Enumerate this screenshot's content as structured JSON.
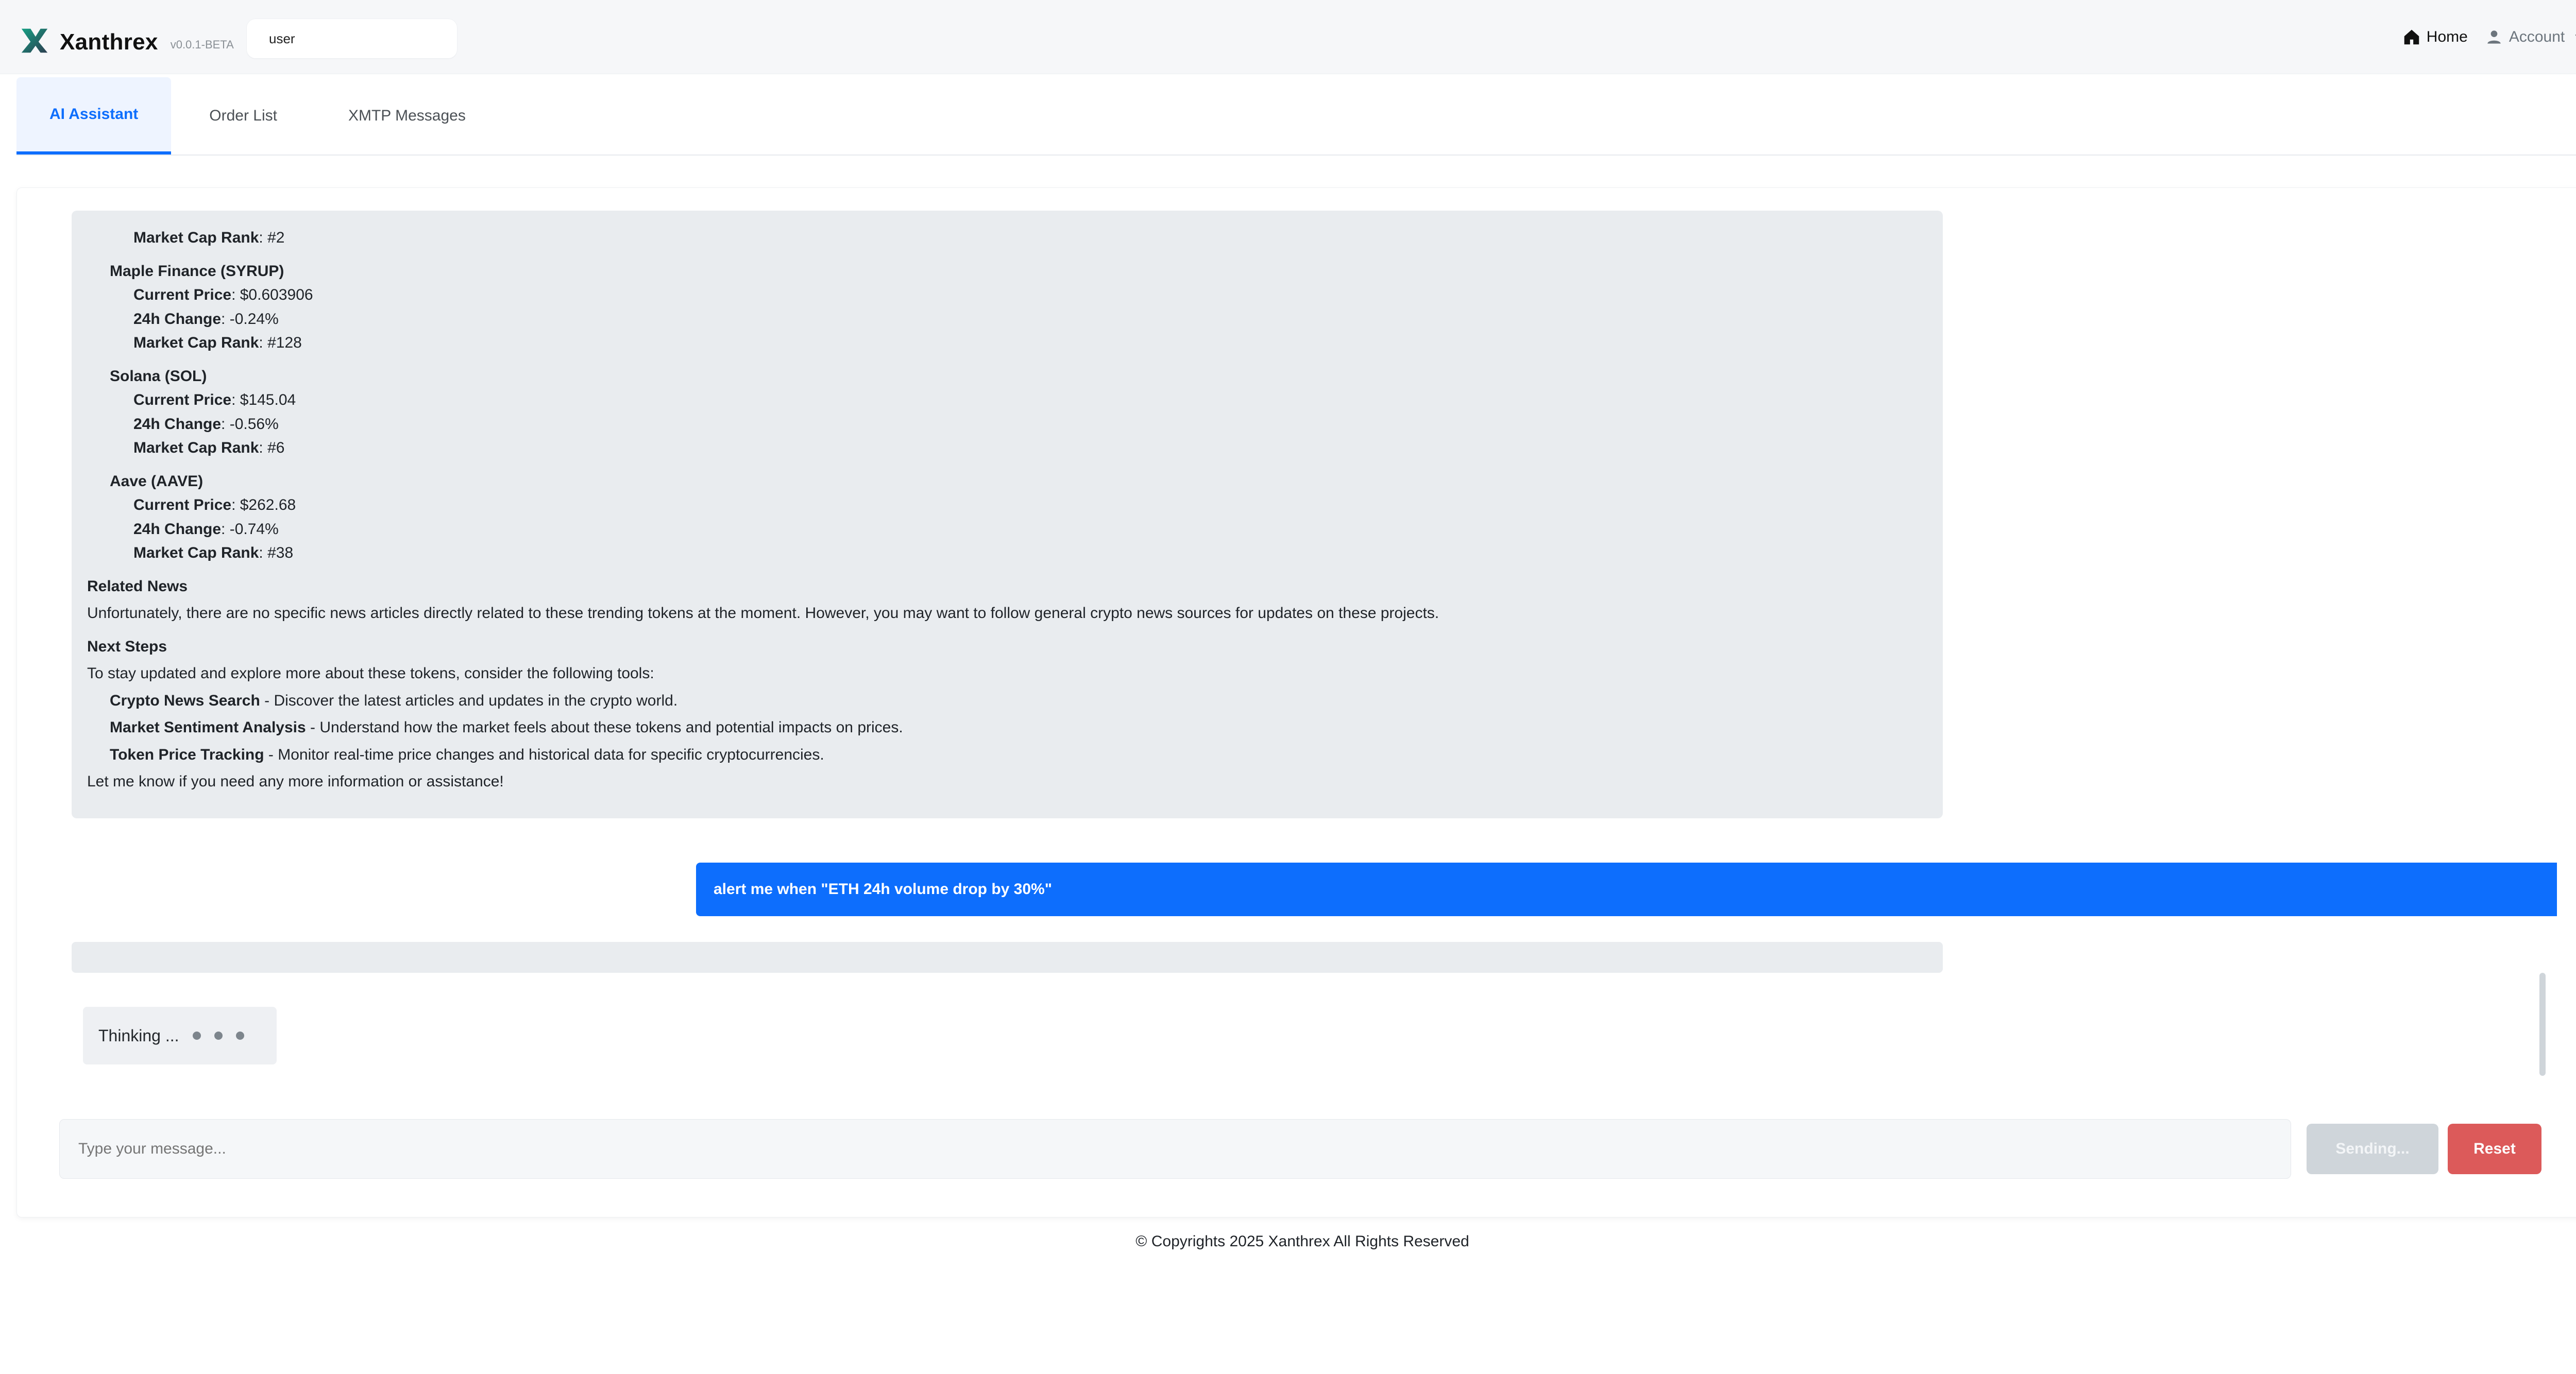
{
  "header": {
    "brand": "Xanthrex",
    "version": "v0.0.1-BETA",
    "user_label": "user",
    "nav": {
      "home": "Home",
      "account": "Account"
    }
  },
  "tabs": [
    {
      "label": "AI Assistant",
      "active": true
    },
    {
      "label": "Order List",
      "active": false
    },
    {
      "label": "XMTP Messages",
      "active": false
    }
  ],
  "ai": {
    "top_kv": [
      {
        "label": "Market Cap Rank",
        "value": ": #2"
      }
    ],
    "tokens": [
      {
        "title": "Maple Finance (SYRUP)",
        "kv": [
          {
            "label": "Current Price",
            "value": ": $0.603906"
          },
          {
            "label": "24h Change",
            "value": ": -0.24%"
          },
          {
            "label": "Market Cap Rank",
            "value": ": #128"
          }
        ]
      },
      {
        "title": "Solana (SOL)",
        "kv": [
          {
            "label": "Current Price",
            "value": ": $145.04"
          },
          {
            "label": "24h Change",
            "value": ": -0.56%"
          },
          {
            "label": "Market Cap Rank",
            "value": ": #6"
          }
        ]
      },
      {
        "title": "Aave (AAVE)",
        "kv": [
          {
            "label": "Current Price",
            "value": ": $262.68"
          },
          {
            "label": "24h Change",
            "value": ": -0.74%"
          },
          {
            "label": "Market Cap Rank",
            "value": ": #38"
          }
        ]
      }
    ],
    "sections": {
      "related_news_title": "Related News",
      "related_news_text": "Unfortunately, there are no specific news articles directly related to these trending tokens at the moment. However, you may want to follow general crypto news sources for updates on these projects.",
      "next_steps_title": "Next Steps",
      "next_steps_intro": "To stay updated and explore more about these tokens, consider the following tools:",
      "tools": [
        {
          "label": "Crypto News Search",
          "desc": " - Discover the latest articles and updates in the crypto world."
        },
        {
          "label": "Market Sentiment Analysis",
          "desc": " - Understand how the market feels about these tokens and potential impacts on prices."
        },
        {
          "label": "Token Price Tracking",
          "desc": " - Monitor real-time price changes and historical data for specific cryptocurrencies."
        }
      ],
      "closing": "Let me know if you need any more information or assistance!"
    }
  },
  "user_message": "alert me when \"ETH 24h volume drop by 30%\"",
  "thinking_label": "Thinking ...",
  "input": {
    "placeholder": "Type your message...",
    "value": ""
  },
  "buttons": {
    "sending": "Sending...",
    "reset": "Reset"
  },
  "footer": "© Copyrights 2025 Xanthrex All Rights Reserved",
  "colors": {
    "primary": "#0d6efd",
    "danger": "#dc5a5a",
    "muted": "#6c757d",
    "bubble_gray": "#e9ecef"
  }
}
